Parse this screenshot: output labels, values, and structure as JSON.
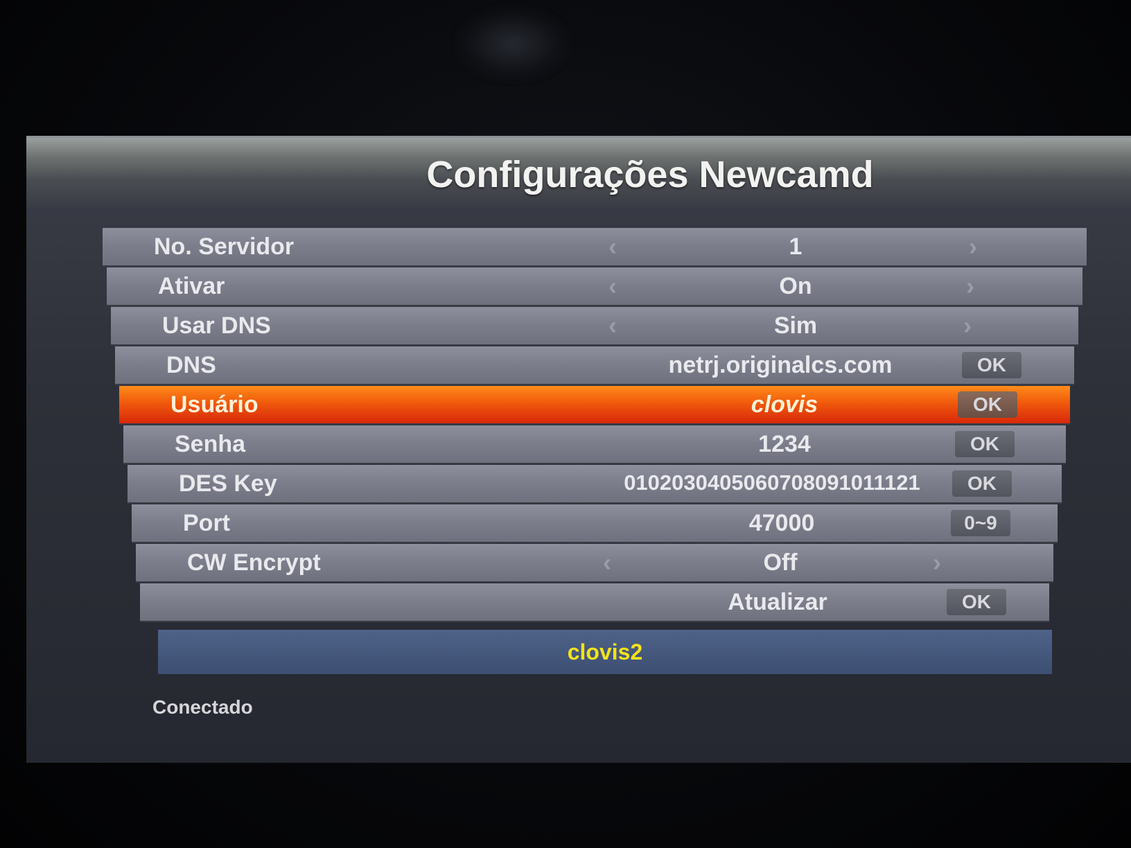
{
  "window": {
    "title": "Configurações Newcamd"
  },
  "menu": {
    "rows": [
      {
        "label": "No. Servidor",
        "value": "1",
        "control": "arrows"
      },
      {
        "label": "Ativar",
        "value": "On",
        "control": "arrows"
      },
      {
        "label": "Usar DNS",
        "value": "Sim",
        "control": "arrows"
      },
      {
        "label": "DNS",
        "value": "netrj.originalcs.com",
        "control": "button",
        "button": "OK"
      },
      {
        "label": "Usuário",
        "value": "clovis",
        "control": "button",
        "button": "OK",
        "selected": true
      },
      {
        "label": "Senha",
        "value": "1234",
        "control": "button",
        "button": "OK"
      },
      {
        "label": "DES Key",
        "value": "0102030405060708091011121",
        "control": "button",
        "button": "OK"
      },
      {
        "label": "Port",
        "value": "47000",
        "control": "button",
        "button": "0~9"
      },
      {
        "label": "CW Encrypt",
        "value": "Off",
        "control": "arrows"
      },
      {
        "label": "",
        "value": "Atualizar",
        "control": "button",
        "button": "OK"
      }
    ],
    "arrow_left": "‹",
    "arrow_right": "›"
  },
  "info_bar": {
    "text": "clovis2"
  },
  "status": {
    "text": "Conectado"
  },
  "colors": {
    "highlight": "#f05a0c",
    "info_text": "#f3e21c",
    "info_bar": "#4e6288"
  }
}
